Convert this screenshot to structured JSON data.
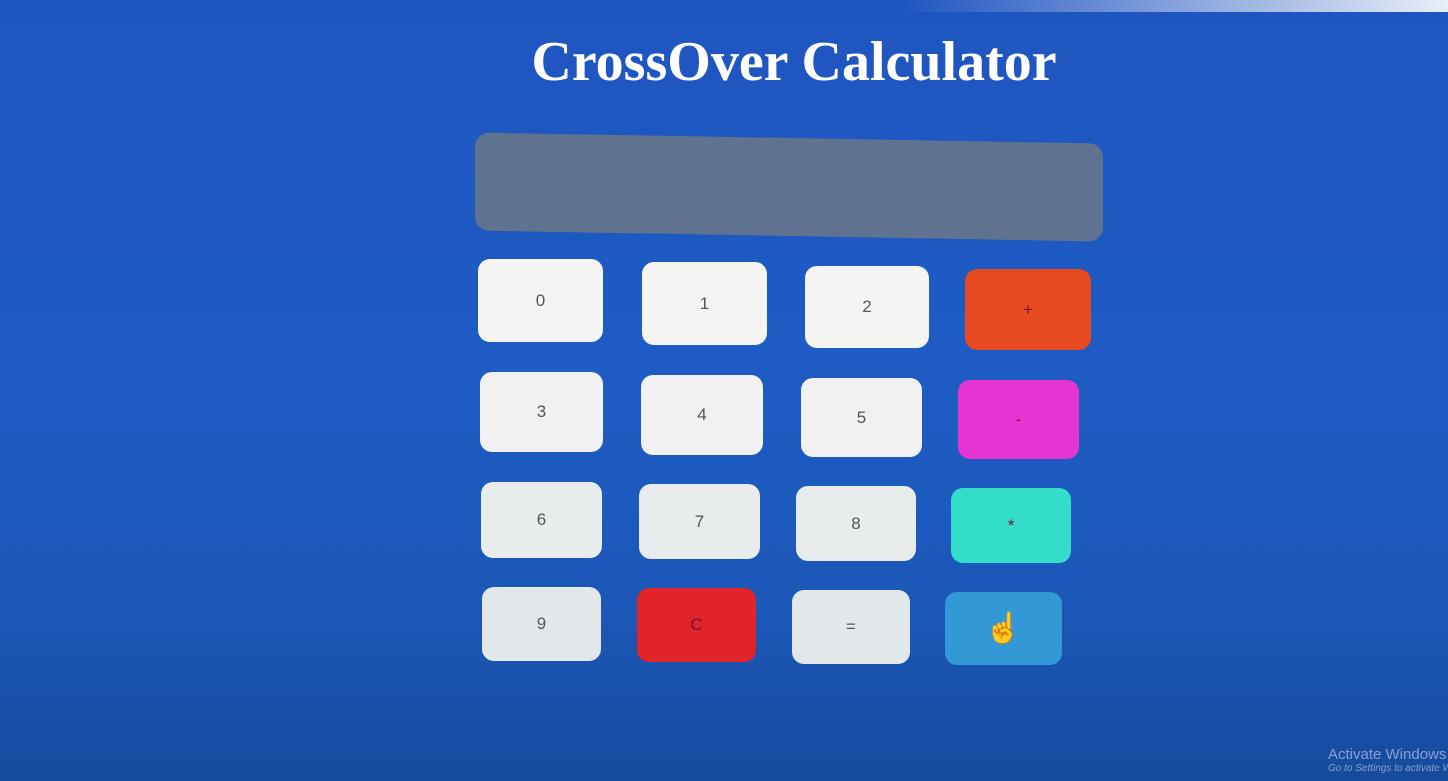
{
  "title": "CrossOver Calculator",
  "display": {
    "value": ""
  },
  "buttons": [
    {
      "label": "0",
      "color": "#f4f4f2"
    },
    {
      "label": "1",
      "color": "#f4f4f2"
    },
    {
      "label": "2",
      "color": "#f4f4f2"
    },
    {
      "label": "+",
      "color": "#e84a22"
    },
    {
      "label": "3",
      "color": "#f0f1f0"
    },
    {
      "label": "4",
      "color": "#f0f1f0"
    },
    {
      "label": "5",
      "color": "#f0f1f0"
    },
    {
      "label": "-",
      "color": "#e634d2"
    },
    {
      "label": "6",
      "color": "#e8ecec"
    },
    {
      "label": "7",
      "color": "#e8ecec"
    },
    {
      "label": "8",
      "color": "#e8ecec"
    },
    {
      "label": "*",
      "color": "#34dcca"
    },
    {
      "label": "9",
      "color": "#e2e8ea"
    },
    {
      "label": "C",
      "color": "#e0242a"
    },
    {
      "label": "=",
      "color": "#e2e8ea"
    },
    {
      "label": "",
      "color": "#3398d6",
      "icon": "hand-pointer-cursor-icon"
    }
  ],
  "watermark": {
    "line1": "Activate Windows",
    "line2": "Go to Settings to activate Windows."
  }
}
